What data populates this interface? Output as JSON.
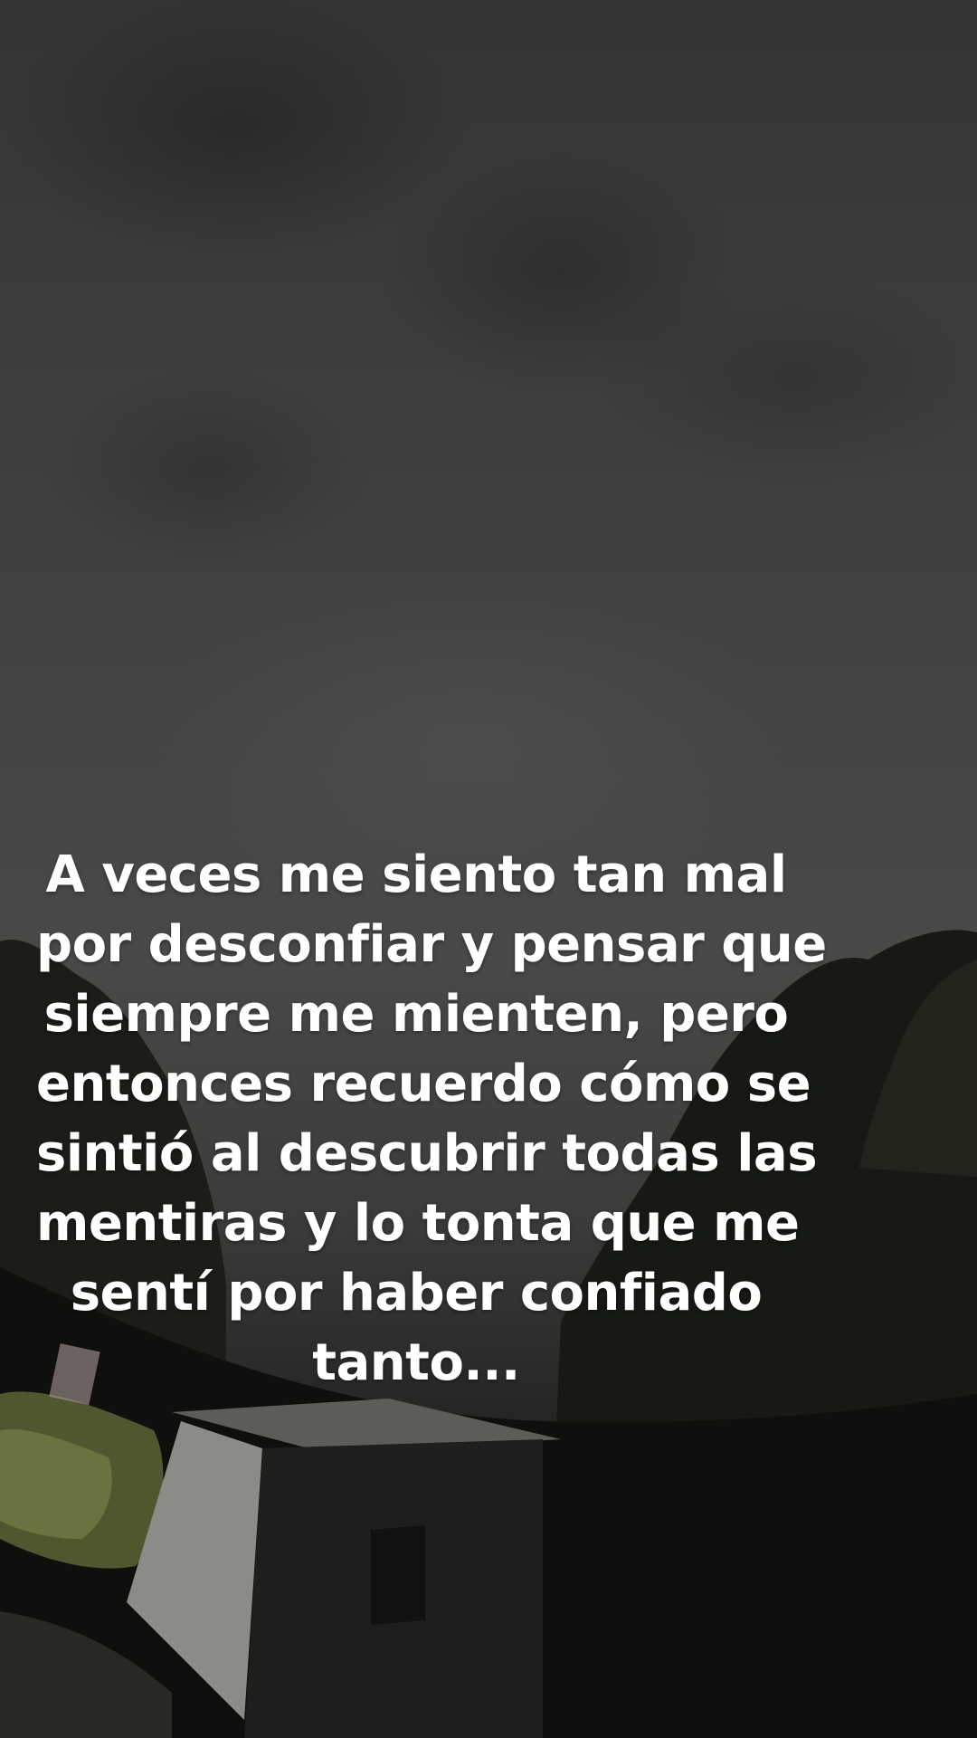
{
  "caption": {
    "lines": [
      "A veces me siento tan mal",
      "por desconfiar y pensar que",
      "siempre me mienten, pero",
      "entonces recuerdo cómo se",
      "sintió al descubrir todas las",
      "mentiras y lo tonta que me",
      "sentí por haber confiado",
      "tanto..."
    ]
  },
  "colors": {
    "caption_text": "#ffffff",
    "sky": "#444341",
    "foliage": "#161a12",
    "shed_wall": "#8a8a86",
    "grass_lit": "#5f6a3a"
  }
}
